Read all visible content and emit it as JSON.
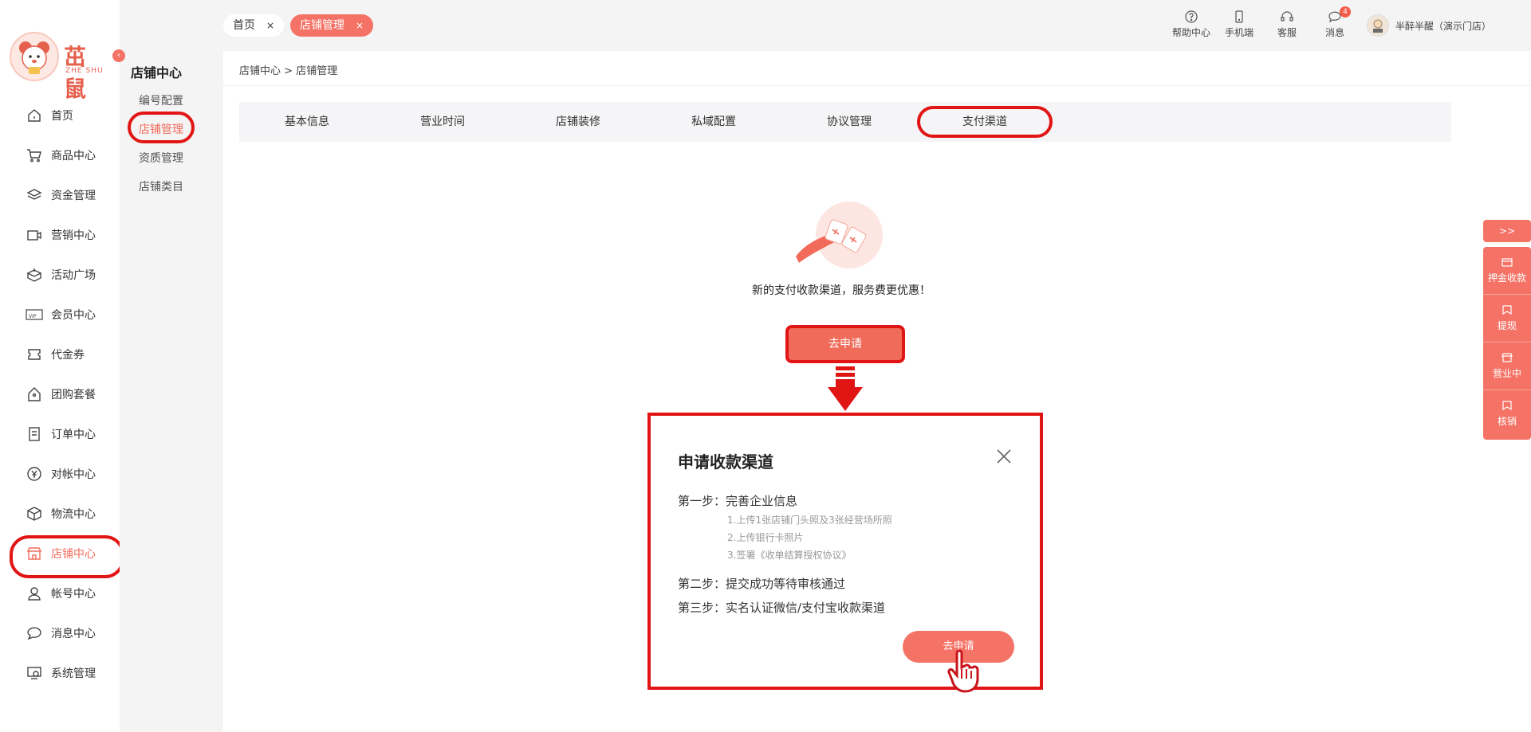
{
  "brand": {
    "logo_text": "茁鼠",
    "logo_sub": "ZHE SHU"
  },
  "sidebar": {
    "items": [
      {
        "label": "首页",
        "icon": "home-icon"
      },
      {
        "label": "商品中心",
        "icon": "cart-icon"
      },
      {
        "label": "资金管理",
        "icon": "layers-icon"
      },
      {
        "label": "营销中心",
        "icon": "camera-icon"
      },
      {
        "label": "活动广场",
        "icon": "box-open-icon"
      },
      {
        "label": "会员中心",
        "icon": "vip-card-icon"
      },
      {
        "label": "代金券",
        "icon": "ticket-icon"
      },
      {
        "label": "团购套餐",
        "icon": "tag-icon"
      },
      {
        "label": "订单中心",
        "icon": "document-icon"
      },
      {
        "label": "对帐中心",
        "icon": "yen-circle-icon"
      },
      {
        "label": "物流中心",
        "icon": "package-icon"
      },
      {
        "label": "店铺中心",
        "icon": "store-icon"
      },
      {
        "label": "帐号中心",
        "icon": "user-icon"
      },
      {
        "label": "消息中心",
        "icon": "chat-icon"
      },
      {
        "label": "系统管理",
        "icon": "monitor-gear-icon"
      }
    ],
    "active_index": 11
  },
  "subbar": {
    "title": "店铺中心",
    "items": [
      "编号配置",
      "店铺管理",
      "资质管理",
      "店铺类目"
    ],
    "active_index": 1
  },
  "topbar": {
    "tabs": [
      {
        "label": "首页",
        "close": "×"
      },
      {
        "label": "店铺管理",
        "close": "×"
      }
    ],
    "icons": [
      {
        "label": "帮助中心",
        "icon": "help-icon"
      },
      {
        "label": "手机端",
        "icon": "phone-icon"
      },
      {
        "label": "客服",
        "icon": "headset-icon"
      },
      {
        "label": "消息",
        "icon": "message-icon",
        "badge": "4"
      }
    ],
    "user_name": "半醉半醒（演示门店）"
  },
  "breadcrumb": {
    "root": "店铺中心",
    "separator": ">",
    "current": "店铺管理"
  },
  "store_tabs": [
    "基本信息",
    "营业时间",
    "店铺装修",
    "私域配置",
    "协议管理",
    "支付渠道"
  ],
  "store_tabs_active": 5,
  "promo": {
    "text": "新的支付收款渠道，服务费更优惠！",
    "button": "去申请"
  },
  "modal": {
    "title": "申请收款渠道",
    "step1": "第一步：完善企业信息",
    "step1_items": [
      "1.上传1张店铺门头照及3张经营场所照",
      "2.上传银行卡照片",
      "3.签署《收单结算授权协议》"
    ],
    "step2": "第二步：提交成功等待审核通过",
    "step3": "第三步：实名认证微信/支付宝收款渠道",
    "button": "去申请"
  },
  "float_panel": {
    "toggle": ">>",
    "items": [
      {
        "label": "押金收款",
        "icon": "deposit-icon"
      },
      {
        "label": "提现",
        "icon": "withdraw-icon"
      },
      {
        "label": "营业中",
        "icon": "shop-open-icon"
      },
      {
        "label": "核销",
        "icon": "verify-icon"
      }
    ]
  },
  "colors": {
    "accent": "#f16b5b",
    "highlight": "#e21515",
    "subbar_bg": "#f4f4f4"
  }
}
